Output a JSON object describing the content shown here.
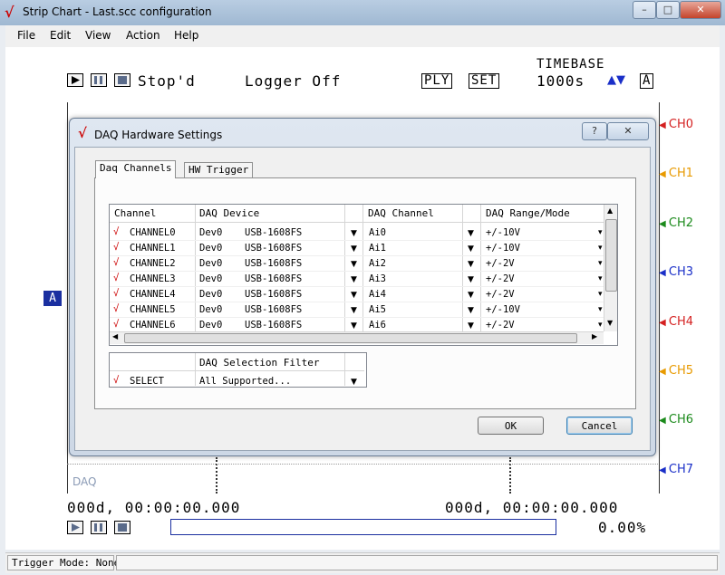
{
  "window": {
    "title": "Strip Chart - Last.scc configuration",
    "controls": [
      "–",
      "□",
      "✕"
    ]
  },
  "menu": [
    "File",
    "Edit",
    "View",
    "Action",
    "Help"
  ],
  "toolbar": {
    "status": "Stop'd",
    "logger": "Logger Off",
    "ply": "PLY",
    "set": "SET",
    "timebase_label": "TIMEBASE",
    "timebase_value": "1000s",
    "timebase_arrows": "▲▼",
    "auto": "A"
  },
  "channels": [
    {
      "label": "CH0",
      "color": "#d42020"
    },
    {
      "label": "CH1",
      "color": "#e89a00"
    },
    {
      "label": "CH2",
      "color": "#1b8a1b"
    },
    {
      "label": "CH3",
      "color": "#1a2fc8"
    },
    {
      "label": "CH4",
      "color": "#d42020"
    },
    {
      "label": "CH5",
      "color": "#e89a00"
    },
    {
      "label": "CH6",
      "color": "#1b8a1b"
    },
    {
      "label": "CH7",
      "color": "#1a2fc8"
    }
  ],
  "plot": {
    "source_label": "DAQ",
    "marker_a": "A",
    "time_left": "000d, 00:00:00.000",
    "time_right": "000d, 00:00:00.000",
    "progress_percent": "0.00%",
    "progress_value": 0
  },
  "statusbar": {
    "trigger_mode": "Trigger Mode:  None"
  },
  "dialog": {
    "title": "DAQ Hardware Settings",
    "help_btn": "?",
    "close_btn": "✕",
    "tabs": [
      "Daq Channels",
      "HW Trigger"
    ],
    "columns": [
      "Channel",
      "DAQ Device",
      "DAQ Channel",
      "DAQ Range/Mode"
    ],
    "rows": [
      {
        "channel": "CHANNEL0",
        "device": "Dev0",
        "model": "USB-1608FS",
        "daq_channel": "Ai0",
        "range": "+/-10V"
      },
      {
        "channel": "CHANNEL1",
        "device": "Dev0",
        "model": "USB-1608FS",
        "daq_channel": "Ai1",
        "range": "+/-10V"
      },
      {
        "channel": "CHANNEL2",
        "device": "Dev0",
        "model": "USB-1608FS",
        "daq_channel": "Ai2",
        "range": "+/-2V"
      },
      {
        "channel": "CHANNEL3",
        "device": "Dev0",
        "model": "USB-1608FS",
        "daq_channel": "Ai3",
        "range": "+/-2V"
      },
      {
        "channel": "CHANNEL4",
        "device": "Dev0",
        "model": "USB-1608FS",
        "daq_channel": "Ai4",
        "range": "+/-2V"
      },
      {
        "channel": "CHANNEL5",
        "device": "Dev0",
        "model": "USB-1608FS",
        "daq_channel": "Ai5",
        "range": "+/-10V"
      },
      {
        "channel": "CHANNEL6",
        "device": "Dev0",
        "model": "USB-1608FS",
        "daq_channel": "Ai6",
        "range": "+/-2V"
      }
    ],
    "filter_header": "DAQ Selection Filter",
    "filter_row": {
      "label": "SELECT",
      "value": "All Supported..."
    },
    "ok": "OK",
    "cancel": "Cancel"
  }
}
